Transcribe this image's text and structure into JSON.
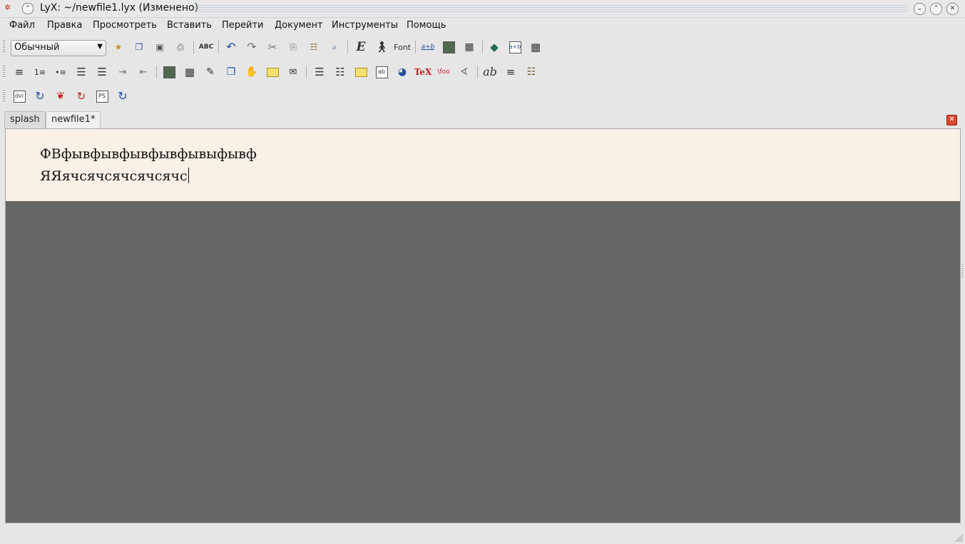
{
  "window": {
    "title": "LyX: ~/newfile1.lyx (Изменено)",
    "buttons": [
      "minimize",
      "maximize",
      "close"
    ]
  },
  "menubar": {
    "items": [
      "Файл",
      "Правка",
      "Просмотреть",
      "Вставить",
      "Перейти",
      "Документ",
      "Инструменты",
      "Помощь"
    ]
  },
  "toolbar1": {
    "paragraph_style": "Обычный",
    "font_label": "Font",
    "spell_label": "ABC",
    "fraction_label": "a+b"
  },
  "toolbar2": {
    "tex_label": "TeX",
    "foo_label": "\\foo",
    "ab_label": "ab"
  },
  "toolbar3": {
    "dvi_label": "dvi",
    "ps_label": "PS"
  },
  "tabs": [
    {
      "label": "splash",
      "active": false
    },
    {
      "label": "newfile1*",
      "active": true
    }
  ],
  "document": {
    "line1": "ФВфывфывфывфывфывыфывф",
    "line2": "ЯЯячсячсячсячсячс"
  },
  "colors": {
    "paper": "#faf0e6",
    "workspace": "#666666",
    "close_tab": "#d84a30"
  }
}
